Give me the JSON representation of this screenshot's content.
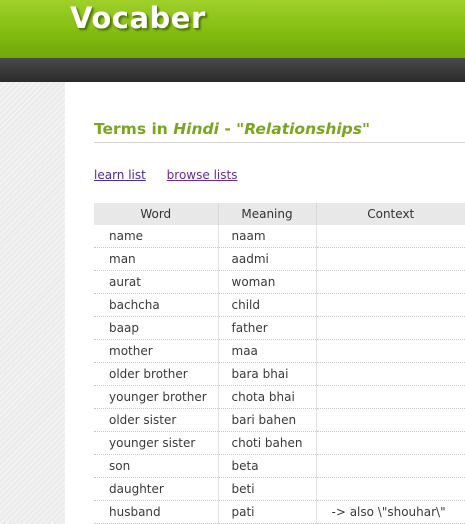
{
  "app": {
    "logo": "Vocaber"
  },
  "page": {
    "title_prefix": "Terms in ",
    "language": "Hindi",
    "title_separator": " - ",
    "list_name": "\"Relationships\""
  },
  "links": {
    "learn": "learn list",
    "browse": "browse lists"
  },
  "table": {
    "headers": [
      "Word",
      "Meaning",
      "Context"
    ],
    "rows": [
      {
        "word": "name",
        "meaning": "naam",
        "context": ""
      },
      {
        "word": "man",
        "meaning": "aadmi",
        "context": ""
      },
      {
        "word": "aurat",
        "meaning": "woman",
        "context": ""
      },
      {
        "word": "bachcha",
        "meaning": "child",
        "context": ""
      },
      {
        "word": "baap",
        "meaning": "father",
        "context": ""
      },
      {
        "word": "mother",
        "meaning": "maa",
        "context": ""
      },
      {
        "word": "older brother",
        "meaning": "bara bhai",
        "context": ""
      },
      {
        "word": "younger brother",
        "meaning": "chota bhai",
        "context": ""
      },
      {
        "word": "older sister",
        "meaning": "bari bahen",
        "context": ""
      },
      {
        "word": "younger sister",
        "meaning": "choti bahen",
        "context": ""
      },
      {
        "word": "son",
        "meaning": "beta",
        "context": ""
      },
      {
        "word": "daughter",
        "meaning": "beti",
        "context": ""
      },
      {
        "word": "husband",
        "meaning": "pati",
        "context": "-> also \\\"shouhar\\\""
      }
    ]
  },
  "colors": {
    "header_green": "#84bd10",
    "title_green": "#78a61c",
    "navbar": "#333333",
    "link": "#4a2aa0"
  }
}
